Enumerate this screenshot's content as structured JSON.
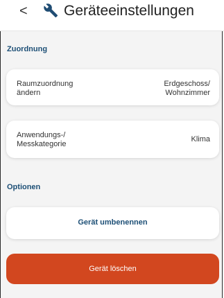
{
  "header": {
    "back_icon": "chevron-left-icon",
    "icon": "wrench-icon",
    "title": "Geräteeinstellungen"
  },
  "sections": {
    "assignment": "Zuordnung",
    "options": "Optionen"
  },
  "room": {
    "label": "Raumzuordnung\nändern",
    "value": "Erdgeschoss/\nWohnzimmer"
  },
  "category": {
    "label": "Anwendungs-/\nMesskategorie",
    "value": "Klima"
  },
  "rename": {
    "label": "Gerät umbenennen"
  },
  "delete": {
    "label": "Gerät löschen"
  },
  "colors": {
    "accent": "#1d4f76",
    "danger": "#d2471f"
  }
}
